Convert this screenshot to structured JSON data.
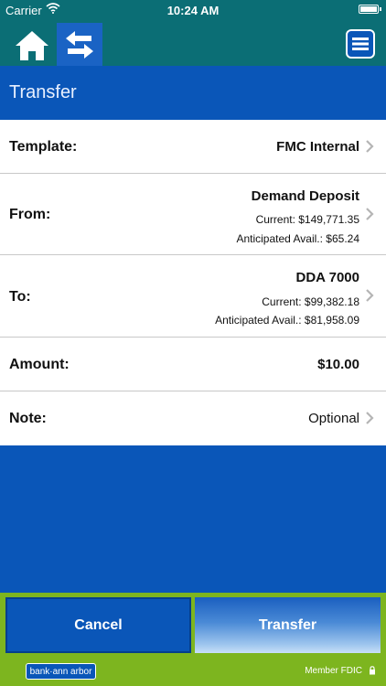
{
  "status_bar": {
    "carrier": "Carrier",
    "time": "10:24 AM"
  },
  "nav": {
    "icons": [
      "home-icon",
      "transfer-arrows-icon",
      "menu-icon"
    ]
  },
  "page": {
    "title": "Transfer"
  },
  "form": {
    "template": {
      "label": "Template:",
      "value": "FMC Internal"
    },
    "from": {
      "label": "From:",
      "account": "Demand Deposit",
      "current": "Current: $149,771.35",
      "anticipated": "Anticipated Avail.: $65.24"
    },
    "to": {
      "label": "To:",
      "account": "DDA 7000",
      "current": "Current: $99,382.18",
      "anticipated": "Anticipated Avail.: $81,958.09"
    },
    "amount": {
      "label": "Amount:",
      "value": "$10.00"
    },
    "note": {
      "label": "Note:",
      "placeholder": "Optional"
    }
  },
  "buttons": {
    "cancel": "Cancel",
    "transfer": "Transfer"
  },
  "footer": {
    "logo_text": "bank·ann arbor",
    "fdic": "Member FDIC"
  },
  "colors": {
    "teal": "#0b6e75",
    "blue": "#0a56b8",
    "green": "#7db51f"
  }
}
